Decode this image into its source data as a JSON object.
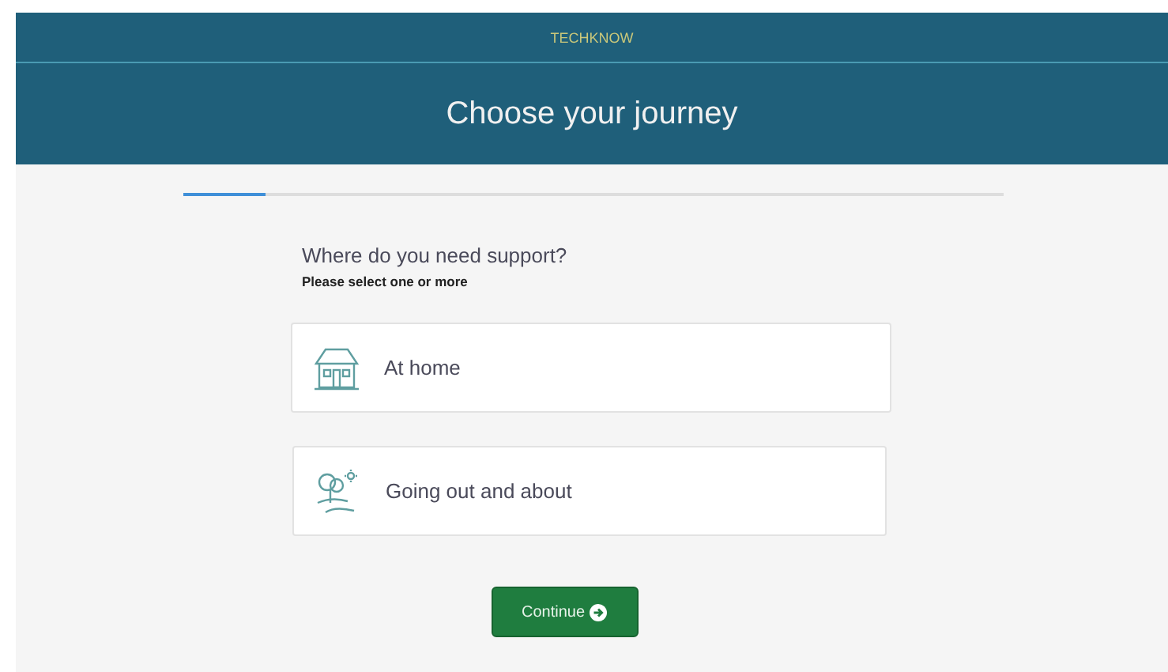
{
  "header": {
    "brand": "TECHKNOW",
    "title": "Choose your journey"
  },
  "progress": {
    "level": 0.1
  },
  "question": {
    "title": "Where do you need support?",
    "hint": "Please select one or more"
  },
  "options": [
    {
      "kind": "home",
      "label": "At home"
    },
    {
      "kind": "outdoors",
      "label": "Going out and about"
    }
  ],
  "button": {
    "label": "Continue"
  }
}
